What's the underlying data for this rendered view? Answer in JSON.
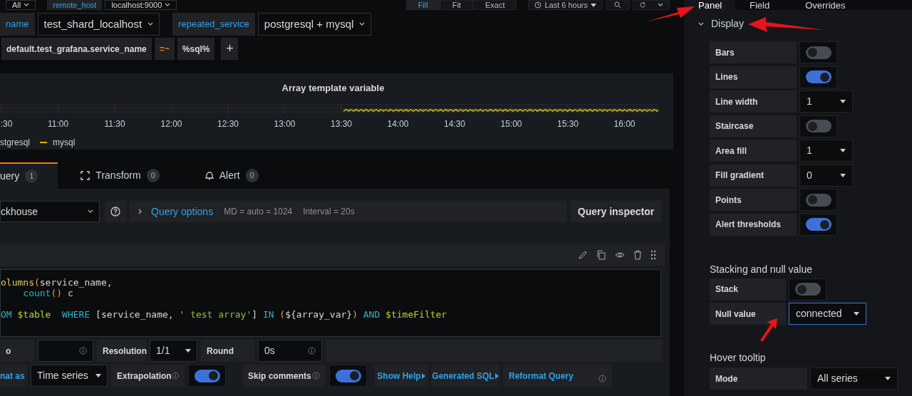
{
  "top_bar": {
    "items": [
      {
        "kind": "select",
        "text": "All"
      },
      {
        "kind": "label",
        "text": "remote_host"
      },
      {
        "kind": "select",
        "text": "localhost:9000"
      }
    ],
    "view_modes": [
      {
        "label": "Fill",
        "selected": true
      },
      {
        "label": "Fit",
        "selected": false
      },
      {
        "label": "Exact",
        "selected": false
      }
    ],
    "time_range": "Last 6 hours"
  },
  "variables_row": [
    {
      "kind": "label",
      "text": "name"
    },
    {
      "kind": "select",
      "text": "test_shard_localhost"
    },
    {
      "kind": "label",
      "text": "repeated_service"
    },
    {
      "kind": "select",
      "text": "postgresql + mysql"
    }
  ],
  "filter_row": [
    {
      "kind": "key",
      "text": "default.test_grafana.service_name"
    },
    {
      "kind": "operator",
      "text": "=~"
    },
    {
      "kind": "value",
      "text": "%sql%"
    },
    {
      "kind": "add",
      "text": "+"
    }
  ],
  "panel": {
    "title": "Array template variable",
    "x_labels": [
      ":30",
      "11:00",
      "11:30",
      "12:00",
      "12:30",
      "13:00",
      "13:30",
      "14:00",
      "14:30",
      "15:00",
      "15:30",
      "16:00"
    ],
    "legend": [
      {
        "name": "stgresql"
      },
      {
        "name": "mysql",
        "color": "#e0b400"
      }
    ]
  },
  "query_tabs": [
    {
      "label": "uery",
      "count": "1",
      "selected": true
    },
    {
      "label": "Transform",
      "count": "0",
      "selected": false
    },
    {
      "label": "Alert",
      "count": "0",
      "selected": false
    }
  ],
  "datasource": "ckhouse",
  "query_options": {
    "label": "Query options",
    "expanded": false,
    "md": "MD = auto = 1024",
    "interval": "Interval = 20s"
  },
  "query_inspector": "Query inspector",
  "code_blocks": [
    [
      [
        {
          "text": "olumns",
          "kind": "function"
        },
        {
          "text": "(",
          "kind": "paren"
        },
        {
          "text": "service_name,",
          "kind": "plain"
        }
      ],
      [
        {
          "text": "    count",
          "kind": "keyword"
        },
        {
          "text": "()",
          "kind": "paren"
        },
        {
          "text": " c",
          "kind": "plain"
        }
      ]
    ],
    [
      [
        {
          "text": "OM",
          "kind": "keyword"
        },
        {
          "text": " $table",
          "kind": "variable"
        },
        {
          "text": "  WHERE",
          "kind": "keyword"
        },
        {
          "text": " [service_name, ",
          "kind": "plain"
        },
        {
          "text": "' test array'",
          "kind": "string"
        },
        {
          "text": "] ",
          "kind": "plain"
        },
        {
          "text": "IN",
          "kind": "keyword"
        },
        {
          "text": " (",
          "kind": "paren"
        },
        {
          "text": "${array_var}",
          "kind": "plain"
        },
        {
          "text": ")",
          "kind": "paren"
        },
        {
          "text": " AND",
          "kind": "keyword"
        },
        {
          "text": " $timeFilter",
          "kind": "variable"
        }
      ]
    ]
  ],
  "options_rows": [
    [
      {
        "kind": "label",
        "text": "o"
      },
      {
        "kind": "input"
      },
      {
        "kind": "label",
        "text": "Resolution"
      },
      {
        "kind": "select",
        "text": "1/1"
      },
      {
        "kind": "label",
        "text": "Round"
      },
      {
        "kind": "input",
        "text": "0s"
      },
      {
        "kind": "filler"
      }
    ],
    [
      {
        "kind": "link_label",
        "text": "nat as"
      },
      {
        "kind": "select",
        "text": "Time series"
      },
      {
        "kind": "label_info",
        "text": "Extrapolation"
      },
      {
        "kind": "switch",
        "on": true
      },
      {
        "kind": "label_info",
        "text": "Skip comments"
      },
      {
        "kind": "switch",
        "on": true
      },
      {
        "kind": "toggle_link",
        "text": "Show Help"
      },
      {
        "kind": "toggle_link",
        "text": "Generated SQL"
      },
      {
        "kind": "link_info",
        "text": "Reformat Query"
      }
    ]
  ],
  "side_tabs": [
    {
      "label": "Panel",
      "selected": true
    },
    {
      "label": "Field",
      "selected": false
    },
    {
      "label": "Overrides",
      "selected": false
    }
  ],
  "display": {
    "title": "Display",
    "expanded": true,
    "options": [
      {
        "kind": "switch",
        "label": "Bars",
        "on": false
      },
      {
        "kind": "switch",
        "label": "Lines",
        "on": true
      },
      {
        "kind": "select",
        "label": "Line width",
        "value": "1",
        "focused": false
      },
      {
        "kind": "switch",
        "label": "Staircase",
        "on": false
      },
      {
        "kind": "select",
        "label": "Area fill",
        "value": "1",
        "focused": false
      },
      {
        "kind": "select",
        "label": "Fill gradient",
        "value": "0",
        "focused": false
      },
      {
        "kind": "switch",
        "label": "Points",
        "on": false
      },
      {
        "kind": "switch",
        "label": "Alert thresholds",
        "on": true
      }
    ]
  },
  "stacking": {
    "title": "Stacking and null value",
    "options": [
      {
        "kind": "switch",
        "label": "Stack",
        "on": false
      },
      {
        "kind": "select",
        "label": "Null value",
        "value": "connected",
        "focused": true
      }
    ]
  },
  "hover_tooltip": {
    "title": "Hover tooltip",
    "options": [
      {
        "kind": "select",
        "label": "Mode",
        "value": "All series",
        "focused": false
      }
    ]
  }
}
